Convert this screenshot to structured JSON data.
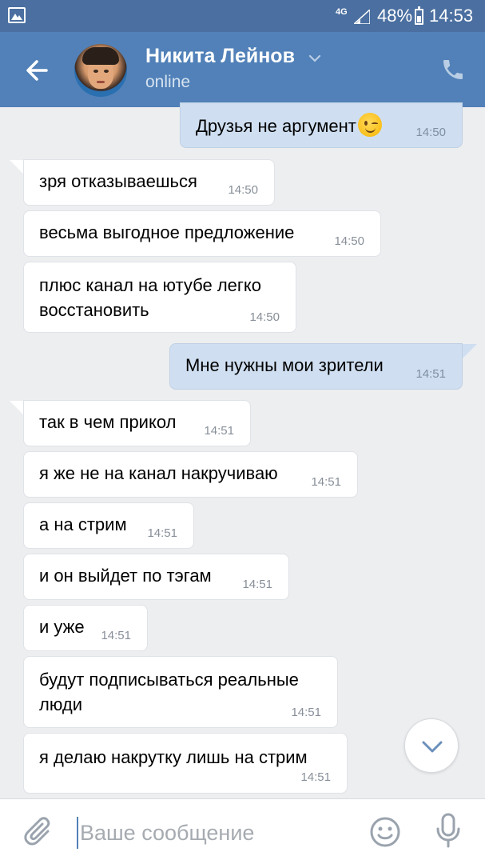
{
  "status_bar": {
    "network": "4G",
    "battery_percent": "48%",
    "time": "14:53"
  },
  "header": {
    "contact_name": "Никита Лейнов",
    "contact_status": "online"
  },
  "messages": [
    {
      "direction": "out",
      "text": "Друзья не аргумент",
      "emoji": "wink",
      "time": "14:50"
    },
    {
      "direction": "in",
      "text": "зря отказываешься",
      "time": "14:50"
    },
    {
      "direction": "in",
      "text": "весьма выгодное предложение",
      "time": "14:50"
    },
    {
      "direction": "in",
      "text": "плюс канал на ютубе легко восстановить",
      "time": "14:50"
    },
    {
      "direction": "out",
      "text": "Мне нужны мои зрители",
      "time": "14:51"
    },
    {
      "direction": "in",
      "text": "так в чем прикол",
      "time": "14:51"
    },
    {
      "direction": "in",
      "text": "я же не на канал накручиваю",
      "time": "14:51"
    },
    {
      "direction": "in",
      "text": "а на стрим",
      "time": "14:51"
    },
    {
      "direction": "in",
      "text": "и он выйдет по тэгам",
      "time": "14:51"
    },
    {
      "direction": "in",
      "text": "и уже",
      "time": "14:51"
    },
    {
      "direction": "in",
      "text": "будут подписываться реальные люди",
      "time": "14:51"
    },
    {
      "direction": "in",
      "text": "я делаю накрутку лишь на стрим",
      "time": "14:51"
    }
  ],
  "composer": {
    "placeholder": "Ваше сообщение"
  },
  "icons": {
    "status_image": "image-icon",
    "signal": "signal-icon",
    "battery": "battery-icon",
    "back": "arrow-left-icon",
    "chevron": "chevron-down-icon",
    "phone": "phone-icon",
    "scroll_down": "chevron-down-icon",
    "attach": "paperclip-icon",
    "emoji": "smile-icon",
    "mic": "microphone-icon"
  },
  "colors": {
    "header": "#5181b8",
    "status_bar": "#4a6fa0",
    "outgoing_bubble": "#cfdff1",
    "incoming_bubble": "#ffffff",
    "background": "#edeef0"
  }
}
